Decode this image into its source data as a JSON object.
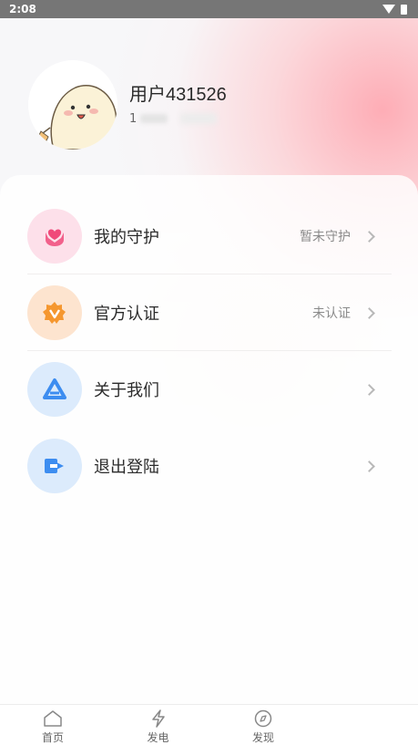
{
  "status_bar": {
    "time": "2:08"
  },
  "profile": {
    "username": "用户431526",
    "user_id_prefix": "1"
  },
  "menu": [
    {
      "icon": "heart-hands-icon",
      "label": "我的守护",
      "status": "暂未守护",
      "icon_bg": "#fde0ea",
      "icon_color": "#f0497a"
    },
    {
      "icon": "verified-badge-icon",
      "label": "官方认证",
      "status": "未认证",
      "icon_bg": "#fde4cf",
      "icon_color": "#f5972f"
    },
    {
      "icon": "triangle-logo-icon",
      "label": "关于我们",
      "status": "",
      "icon_bg": "#dcebfc",
      "icon_color": "#3d8df0"
    },
    {
      "icon": "logout-icon",
      "label": "退出登陆",
      "status": "",
      "icon_bg": "#dcebfc",
      "icon_color": "#3d8df0"
    }
  ],
  "bottom_nav": [
    {
      "icon": "home-icon",
      "label": "首页"
    },
    {
      "icon": "lightning-icon",
      "label": "发电"
    },
    {
      "icon": "compass-icon",
      "label": "发现"
    }
  ]
}
